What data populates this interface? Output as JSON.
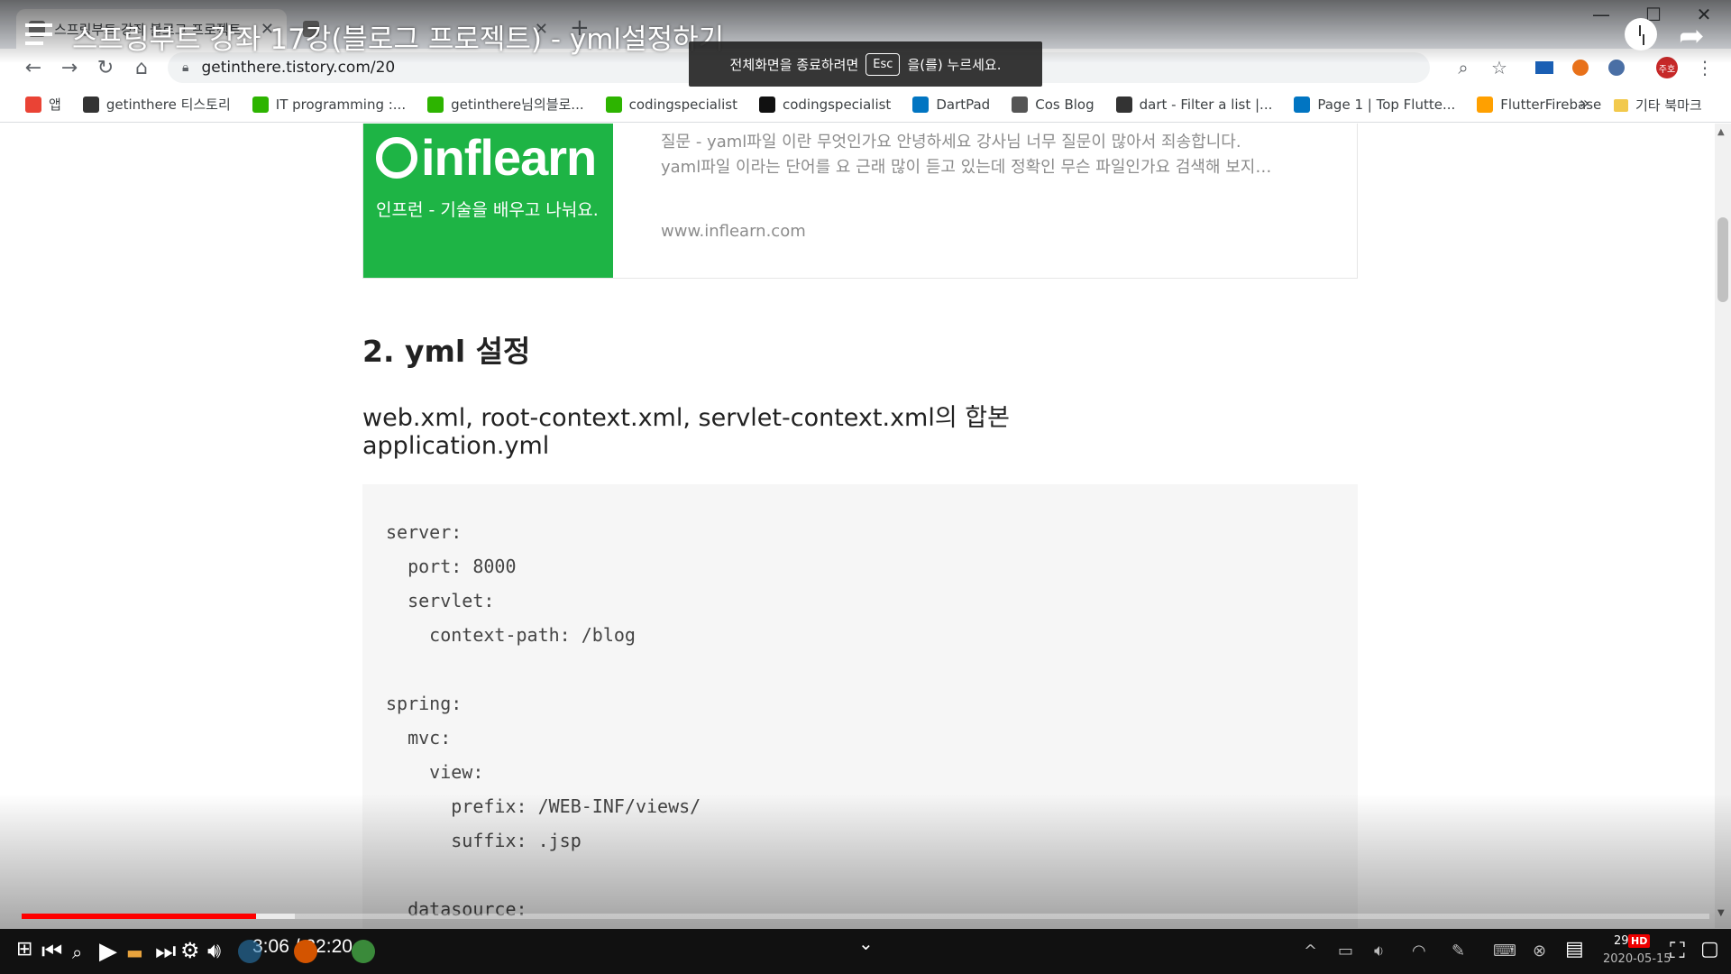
{
  "video": {
    "title": "스프링부트 강좌 17강(블로그 프로젝트) - yml설정하기",
    "fullscreen_toast": {
      "before": "전체화면을 종료하려면",
      "key": "Esc",
      "after": "을(를) 누르세요."
    },
    "current_time": "3:06",
    "duration": "22:20",
    "time_display": "3:06 / 22:20",
    "progress_played": 0.139,
    "progress_buffered": 0.162,
    "hd_badge": "HD"
  },
  "browser": {
    "tabs": [
      {
        "title": "스프링부트 강좌 블로그 프로젝트"
      },
      {
        "title": ""
      }
    ],
    "url": "getinthere.tistory.com/20",
    "bookmarks": [
      {
        "label": "앱",
        "icon": "apps-grid-icon",
        "color": "#ea4335"
      },
      {
        "label": "getinthere 티스토리",
        "icon": "tistory-icon",
        "color": "#333333"
      },
      {
        "label": "IT programming :...",
        "icon": "blog-icon",
        "color": "#2db400"
      },
      {
        "label": "getinthere님의블로...",
        "icon": "blog-icon",
        "color": "#2db400"
      },
      {
        "label": "codingspecialist",
        "icon": "blog-icon",
        "color": "#2db400"
      },
      {
        "label": "codingspecialist",
        "icon": "github-icon",
        "color": "#111111"
      },
      {
        "label": "DartPad",
        "icon": "dart-icon",
        "color": "#0175c2"
      },
      {
        "label": "Cos Blog",
        "icon": "globe-icon",
        "color": "#555555"
      },
      {
        "label": "dart - Filter a list |...",
        "icon": "butler-icon",
        "color": "#333333"
      },
      {
        "label": "Page 1 | Top Flutte...",
        "icon": "flutter-icon",
        "color": "#0175c2"
      },
      {
        "label": "FlutterFirebase",
        "icon": "firebase-icon",
        "color": "#ffa000"
      }
    ],
    "bookmarks_more": "»",
    "other_bookmarks": "기타 북마크",
    "profile_label": "주호"
  },
  "page": {
    "link_card": {
      "logo_text": "inflearn",
      "logo_tagline": "인프런 - 기술을 배우고 나눠요.",
      "desc_line1": "질문 - yaml파일 이란 무엇인가요 안녕하세요 강사님 너무 질문이 많아서 죄송합니다.",
      "desc_line2": "yaml파일 이라는 단어를 요 근래 많이 듣고 있는데 정확인 무슨 파일인가요 검색해 보지…",
      "host": "www.inflearn.com"
    },
    "heading": "2. yml 설정",
    "para1": "web.xml, root-context.xml, servlet-context.xml의 합본",
    "para2": "application.yml",
    "code_lines": [
      "server:",
      "  port: 8000",
      "  servlet:",
      "    context-path: /blog",
      "",
      "spring:",
      "  mvc:",
      "    view:",
      "      prefix: /WEB-INF/views/",
      "      suffix: .jsp",
      "",
      "  datasource:"
    ]
  },
  "taskbar": {
    "clock_time": "29",
    "clock_date": "2020-05-15"
  },
  "colors": {
    "progress_red": "#ff0000",
    "inflearn_green": "#1eb445"
  }
}
